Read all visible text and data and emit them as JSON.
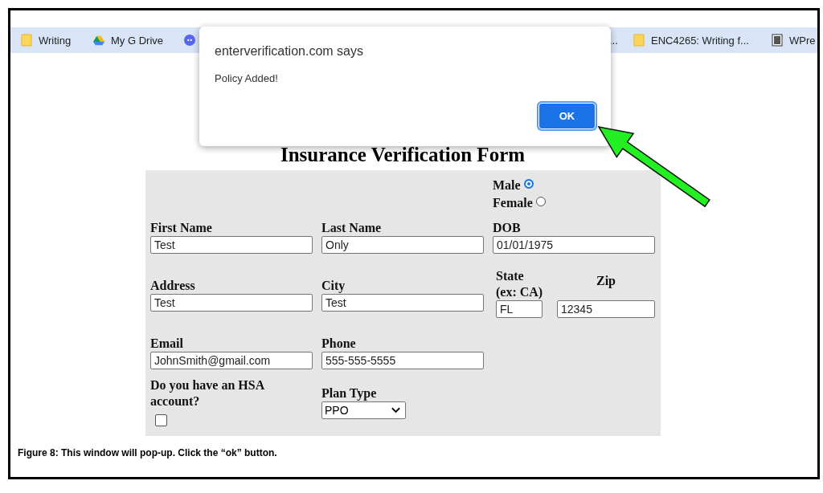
{
  "browser": {
    "bookmarks": [
      {
        "kind": "folder",
        "label": "Writing"
      },
      {
        "kind": "drive",
        "label": "My G Drive"
      },
      {
        "kind": "discord"
      },
      {
        "kind": "hidden",
        "label": "..."
      },
      {
        "kind": "folder",
        "label": "ENC4265: Writing f..."
      },
      {
        "kind": "doc",
        "label": "WPre"
      }
    ]
  },
  "form": {
    "title": "Insurance Verification Form",
    "rows": [
      {
        "cells": [
          "",
          "",
          {
            "kind": "radio",
            "options": [
              {
                "label": "Male",
                "selected": true
              },
              {
                "label": "Female",
                "selected": false
              }
            ]
          }
        ]
      },
      {
        "cells": [
          {
            "kind": "text",
            "label": "First Name",
            "value": "Test"
          },
          {
            "kind": "text",
            "label": "Last Name",
            "value": "Only"
          },
          {
            "kind": "text",
            "label": "DOB",
            "value": "01/01/1975"
          }
        ]
      },
      {
        "cells": [
          {
            "kind": "text",
            "label": "Address",
            "value": "Test"
          },
          {
            "kind": "text",
            "label": "City",
            "value": "Test"
          },
          {
            "kind": "pair",
            "fields": [
              {
                "label": "State (ex: CA)",
                "value": "FL"
              },
              {
                "label": "Zip",
                "value": "12345"
              }
            ]
          }
        ]
      },
      {
        "cells": [
          {
            "kind": "text",
            "label": "Email",
            "value": "JohnSmith@gmail.com"
          },
          {
            "kind": "text",
            "label": "Phone",
            "value": "555-555-5555"
          }
        ]
      },
      {
        "cells": [
          {
            "kind": "checkbox",
            "label": "Do you have an HSA account?",
            "checked": false
          },
          {
            "kind": "select",
            "label": "Plan Type",
            "value": "PPO"
          }
        ]
      }
    ]
  },
  "dialog": {
    "origin": "enterverification.com says",
    "message": "Policy Added!",
    "button": "OK"
  },
  "caption": "Figure 8: This window will pop-up. Click the “ok” button."
}
